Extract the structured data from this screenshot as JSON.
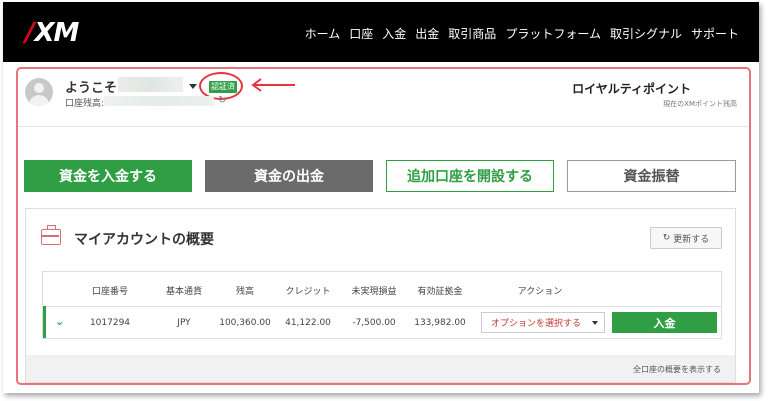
{
  "brand": {
    "logo": "XM"
  },
  "nav": [
    "ホーム",
    "口座",
    "入金",
    "出金",
    "取引商品",
    "プラットフォーム",
    "取引シグナル",
    "サポート"
  ],
  "user": {
    "welcome": "ようこそ",
    "verified_badge": "認証済",
    "balance_label": "口座残高:"
  },
  "loyalty": {
    "title": "ロイヤルティポイント",
    "subtitle": "現在のXMポイント残高"
  },
  "actions": {
    "deposit": "資金を入金する",
    "withdraw": "資金の出金",
    "open_account": "追加口座を開設する",
    "transfer": "資金振替"
  },
  "account_panel": {
    "title": "マイアカウントの概要",
    "refresh": "更新する",
    "columns": [
      "口座番号",
      "基本通貨",
      "残高",
      "クレジット",
      "未実現損益",
      "有効証拠金",
      "アクション"
    ],
    "rows": [
      {
        "number": "1017294",
        "currency": "JPY",
        "balance": "100,360.00",
        "credit": "41,122.00",
        "unrealized": "-7,500.00",
        "equity": "133,982.00"
      }
    ],
    "option_select": "オプションを選択する",
    "row_deposit": "入金",
    "view_all": "全口座の概要を表示する"
  },
  "colors": {
    "brand_green": "#2f9e44",
    "annotation_red": "#e8333e",
    "header_bg": "#000000"
  }
}
